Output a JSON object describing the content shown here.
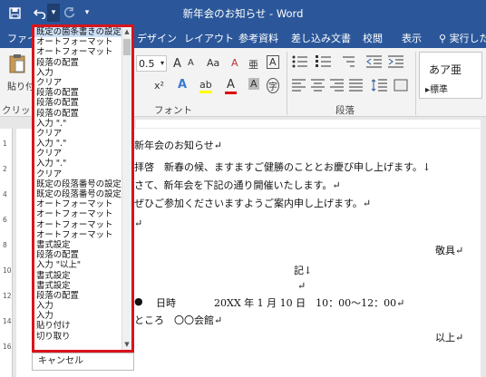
{
  "window": {
    "title": "新年会のお知らせ - Word"
  },
  "qat": {
    "save_icon": "save-icon",
    "undo_icon": "undo-icon",
    "undo_arrow": "▾",
    "redo_icon": "redo-icon",
    "customize": "▾"
  },
  "tabs": [
    {
      "label": "ファイ"
    },
    {
      "label": "デザイン"
    },
    {
      "label": "レイアウト"
    },
    {
      "label": "参考資料"
    },
    {
      "label": "差し込み文書"
    },
    {
      "label": "校閲"
    },
    {
      "label": "表示"
    },
    {
      "label": "実行したい"
    }
  ],
  "ribbon": {
    "paste_label": "貼り付",
    "clipboard_label": "クリップ",
    "font_size": "0.5",
    "grow_font": "A",
    "shrink_font": "A",
    "change_case": "Aa",
    "clear_format": "A",
    "phonetic": "亜",
    "char_border": "A",
    "superscript": "x²",
    "text_effects": "A",
    "highlight": "ab",
    "font_color": "A",
    "char_shading": "A",
    "enclose": "字",
    "font_group_label": "フォント",
    "paragraph_group_label": "段落",
    "style_preview": "あア亜",
    "style_name": "標準",
    "tell_me": "実行したい"
  },
  "undo_list": {
    "items": [
      "既定の箇条書きの設定",
      "オートフォーマット",
      "オートフォーマット",
      "段落の配置",
      "入力",
      "クリア",
      "段落の配置",
      "段落の配置",
      "段落の配置",
      "入力 \".\"",
      "クリア",
      "入力 \".\"",
      "クリア",
      "入力 \".\"",
      "クリア",
      "既定の段落番号の設定",
      "既定の段落番号の設定",
      "オートフォーマット",
      "オートフォーマット",
      "オートフォーマット",
      "オートフォーマット",
      "書式設定",
      "段落の配置",
      "入力 \"以上\"",
      "書式設定",
      "書式設定",
      "段落の配置",
      "入力",
      "入力",
      "貼り付け",
      "切り取り"
    ],
    "cancel_label": "キャンセル"
  },
  "document": {
    "line1": "新年会のお知らせ↵",
    "line2": "拝啓　新春の候、ますますご健勝のこととお慶び申し上げます。↓",
    "line3": "さて、新年会を下記の通り開催いたします。↵",
    "line4": "ぜひご参加くださいますようご案内申し上げます。↵",
    "line5": "↵",
    "keigu": "敬具↵",
    "ki": "記↓",
    "line6": "↵",
    "date_bullet": "●",
    "date_label": "日時",
    "date_value": "20XX 年 1 月 10 日　10：00～12：00↵",
    "place": "ところ　〇〇会館↵",
    "ijou": "以上↵"
  }
}
